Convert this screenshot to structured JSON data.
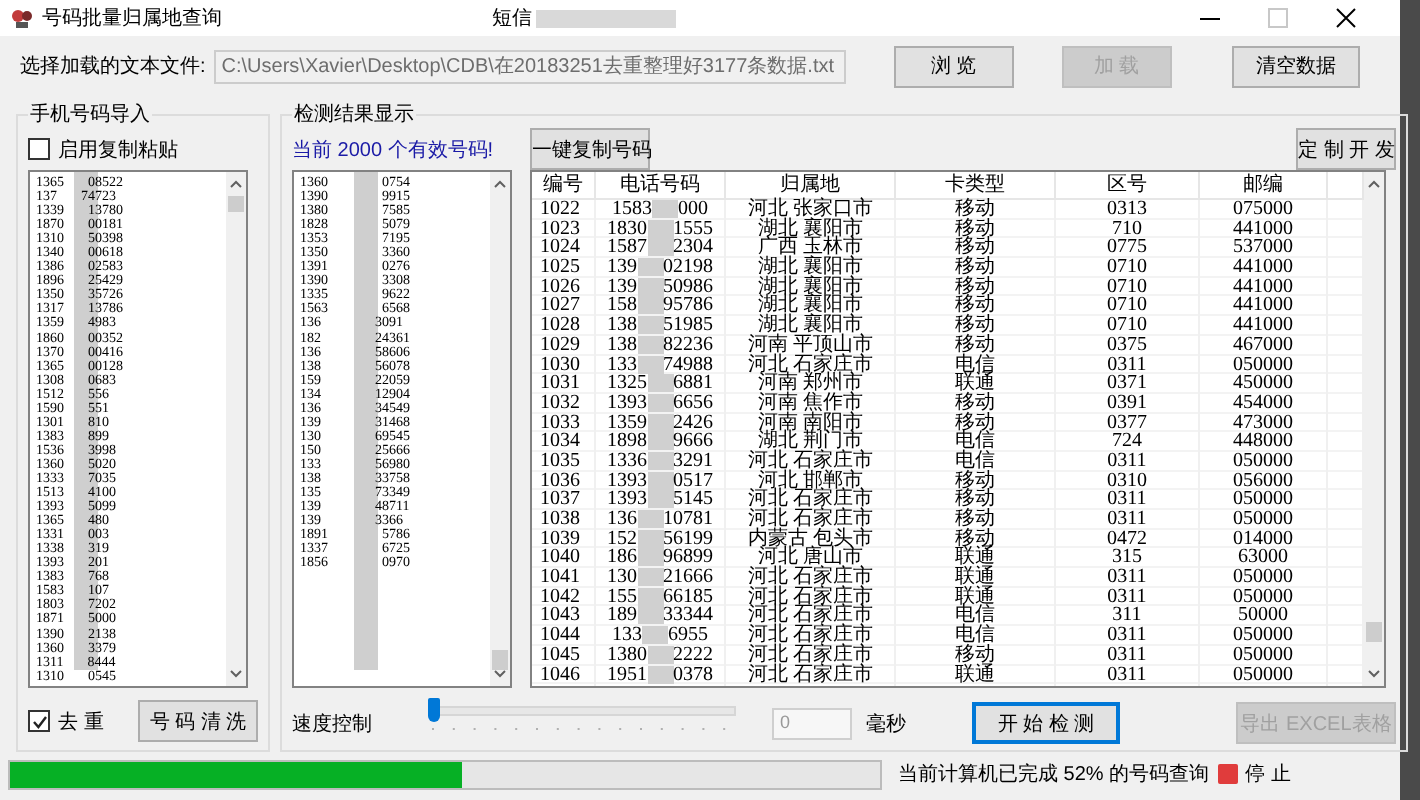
{
  "window": {
    "title": "号码批量归属地查询",
    "center_title": "短信"
  },
  "file_row": {
    "label": "选择加载的文本文件:",
    "path": "C:\\Users\\Xavier\\Desktop\\CDB\\在20183251去重整理好3177条数据.txt",
    "buttons": [
      {
        "label": "浏 览",
        "disabled": false
      },
      {
        "label": "加 载",
        "disabled": true
      },
      {
        "label": "清空数据",
        "disabled": false
      }
    ]
  },
  "import_panel": {
    "title": "手机号码导入",
    "paste_checkbox": {
      "label": "启用复制粘贴",
      "checked": false
    },
    "numbers": [
      {
        "start": "1365",
        "end": "08522"
      },
      {
        "start": "137",
        "end": "74723"
      },
      {
        "start": "1339",
        "end": "13780"
      },
      {
        "start": "1870",
        "end": "00181"
      },
      {
        "start": "1310",
        "end": "50398"
      },
      {
        "start": "1340",
        "end": "00618"
      },
      {
        "start": "1386",
        "end": "02583"
      },
      {
        "start": "1896",
        "end": "25429"
      },
      {
        "start": "1350",
        "end": "35726"
      },
      {
        "start": "1317",
        "end": "13786"
      },
      {
        "start": "1359",
        "end": "4983"
      },
      {
        "start": "1860",
        "end": "00352"
      },
      {
        "start": "1370",
        "end": "00416"
      },
      {
        "start": "1365",
        "end": "00128"
      },
      {
        "start": "1308",
        "end": "0683"
      },
      {
        "start": "1512",
        "end": "556"
      },
      {
        "start": "1590",
        "end": "551"
      },
      {
        "start": "1301",
        "end": "810"
      },
      {
        "start": "1383",
        "end": "899"
      },
      {
        "start": "1536",
        "end": "3998"
      },
      {
        "start": "1360",
        "end": "5020"
      },
      {
        "start": "1333",
        "end": "7035"
      },
      {
        "start": "1513",
        "end": "4100"
      },
      {
        "start": "1393",
        "end": "5099"
      },
      {
        "start": "1365",
        "end": "480"
      },
      {
        "start": "1331",
        "end": "003"
      },
      {
        "start": "1338",
        "end": "319"
      },
      {
        "start": "1393",
        "end": "201"
      },
      {
        "start": "1383",
        "end": "768"
      },
      {
        "start": "1583",
        "end": "107"
      },
      {
        "start": "1803",
        "end": "7202"
      },
      {
        "start": "1871",
        "end": "5000"
      },
      {
        "start": "1390",
        "end": "2138"
      },
      {
        "start": "1360",
        "end": "3379"
      },
      {
        "start": "1311",
        "end": "8444"
      },
      {
        "start": "1310",
        "end": "0545"
      }
    ],
    "dedupe_checkbox": {
      "label": "去 重",
      "checked": true
    },
    "clean_button": "号 码 清 洗"
  },
  "results_panel": {
    "title": "检测结果显示",
    "count_text": "当前 2000 个有效号码!",
    "copy_button": "一键复制号码",
    "custom_button": "定 制 开 发",
    "numbers": [
      {
        "start": "1360",
        "end": "0754"
      },
      {
        "start": "1390",
        "end": "9915"
      },
      {
        "start": "1380",
        "end": "7585"
      },
      {
        "start": "1828",
        "end": "5079"
      },
      {
        "start": "1353",
        "end": "7195"
      },
      {
        "start": "1350",
        "end": "3360"
      },
      {
        "start": "1391",
        "end": "0276"
      },
      {
        "start": "1390",
        "end": "3308"
      },
      {
        "start": "1335",
        "end": "9622"
      },
      {
        "start": "1563",
        "end": "6568"
      },
      {
        "start": "136",
        "end": "3091"
      },
      {
        "start": "182",
        "end": "24361"
      },
      {
        "start": "136",
        "end": "58606"
      },
      {
        "start": "138",
        "end": "56078"
      },
      {
        "start": "159",
        "end": "22059"
      },
      {
        "start": "134",
        "end": "12904"
      },
      {
        "start": "136",
        "end": "34549"
      },
      {
        "start": "139",
        "end": "31468"
      },
      {
        "start": "130",
        "end": "69545"
      },
      {
        "start": "150",
        "end": "25666"
      },
      {
        "start": "133",
        "end": "56980"
      },
      {
        "start": "138",
        "end": "33758"
      },
      {
        "start": "135",
        "end": "73349"
      },
      {
        "start": "139",
        "end": "48711"
      },
      {
        "start": "139",
        "end": "3366"
      },
      {
        "start": "1891",
        "end": "5786"
      },
      {
        "start": "1337",
        "end": "6725"
      },
      {
        "start": "1856",
        "end": "0970"
      }
    ],
    "table": {
      "columns": [
        "编号",
        "电话号码",
        "归属地",
        "卡类型",
        "区号",
        "邮编"
      ],
      "rows": [
        {
          "id": "1022",
          "phone_start": "1583",
          "phone_end": "000",
          "location": "河北 张家口市",
          "carrier": "移动",
          "area_code": "0313",
          "postcode": "075000"
        },
        {
          "id": "1023",
          "phone_start": "1830",
          "phone_end": "1555",
          "location": "湖北 襄阳市",
          "carrier": "移动",
          "area_code": "710",
          "postcode": "441000"
        },
        {
          "id": "1024",
          "phone_start": "1587",
          "phone_end": "2304",
          "location": "广西 玉林市",
          "carrier": "移动",
          "area_code": "0775",
          "postcode": "537000"
        },
        {
          "id": "1025",
          "phone_start": "139",
          "phone_end": "02198",
          "location": "湖北 襄阳市",
          "carrier": "移动",
          "area_code": "0710",
          "postcode": "441000"
        },
        {
          "id": "1026",
          "phone_start": "139",
          "phone_end": "50986",
          "location": "湖北 襄阳市",
          "carrier": "移动",
          "area_code": "0710",
          "postcode": "441000"
        },
        {
          "id": "1027",
          "phone_start": "158",
          "phone_end": "95786",
          "location": "湖北 襄阳市",
          "carrier": "移动",
          "area_code": "0710",
          "postcode": "441000"
        },
        {
          "id": "1028",
          "phone_start": "138",
          "phone_end": "51985",
          "location": "湖北 襄阳市",
          "carrier": "移动",
          "area_code": "0710",
          "postcode": "441000"
        },
        {
          "id": "1029",
          "phone_start": "138",
          "phone_end": "82236",
          "location": "河南 平顶山市",
          "carrier": "移动",
          "area_code": "0375",
          "postcode": "467000"
        },
        {
          "id": "1030",
          "phone_start": "133",
          "phone_end": "74988",
          "location": "河北 石家庄市",
          "carrier": "电信",
          "area_code": "0311",
          "postcode": "050000"
        },
        {
          "id": "1031",
          "phone_start": "1325",
          "phone_end": "6881",
          "location": "河南 郑州市",
          "carrier": "联通",
          "area_code": "0371",
          "postcode": "450000"
        },
        {
          "id": "1032",
          "phone_start": "1393",
          "phone_end": "6656",
          "location": "河南 焦作市",
          "carrier": "移动",
          "area_code": "0391",
          "postcode": "454000"
        },
        {
          "id": "1033",
          "phone_start": "1359",
          "phone_end": "2426",
          "location": "河南 南阳市",
          "carrier": "移动",
          "area_code": "0377",
          "postcode": "473000"
        },
        {
          "id": "1034",
          "phone_start": "1898",
          "phone_end": "9666",
          "location": "湖北 荆门市",
          "carrier": "电信",
          "area_code": "724",
          "postcode": "448000"
        },
        {
          "id": "1035",
          "phone_start": "1336",
          "phone_end": "3291",
          "location": "河北 石家庄市",
          "carrier": "电信",
          "area_code": "0311",
          "postcode": "050000"
        },
        {
          "id": "1036",
          "phone_start": "1393",
          "phone_end": "0517",
          "location": "河北 邯郸市",
          "carrier": "移动",
          "area_code": "0310",
          "postcode": "056000"
        },
        {
          "id": "1037",
          "phone_start": "1393",
          "phone_end": "5145",
          "location": "河北 石家庄市",
          "carrier": "移动",
          "area_code": "0311",
          "postcode": "050000"
        },
        {
          "id": "1038",
          "phone_start": "136",
          "phone_end": "10781",
          "location": "河北 石家庄市",
          "carrier": "移动",
          "area_code": "0311",
          "postcode": "050000"
        },
        {
          "id": "1039",
          "phone_start": "152",
          "phone_end": "56199",
          "location": "内蒙古 包头市",
          "carrier": "移动",
          "area_code": "0472",
          "postcode": "014000"
        },
        {
          "id": "1040",
          "phone_start": "186",
          "phone_end": "96899",
          "location": "河北 唐山市",
          "carrier": "联通",
          "area_code": "315",
          "postcode": "63000"
        },
        {
          "id": "1041",
          "phone_start": "130",
          "phone_end": "21666",
          "location": "河北 石家庄市",
          "carrier": "联通",
          "area_code": "0311",
          "postcode": "050000"
        },
        {
          "id": "1042",
          "phone_start": "155",
          "phone_end": "66185",
          "location": "河北 石家庄市",
          "carrier": "联通",
          "area_code": "0311",
          "postcode": "050000"
        },
        {
          "id": "1043",
          "phone_start": "189",
          "phone_end": "33344",
          "location": "河北 石家庄市",
          "carrier": "电信",
          "area_code": "311",
          "postcode": "50000"
        },
        {
          "id": "1044",
          "phone_start": "133",
          "phone_end": "6955",
          "location": "河北 石家庄市",
          "carrier": "电信",
          "area_code": "0311",
          "postcode": "050000"
        },
        {
          "id": "1045",
          "phone_start": "1380",
          "phone_end": "2222",
          "location": "河北 石家庄市",
          "carrier": "移动",
          "area_code": "0311",
          "postcode": "050000"
        },
        {
          "id": "1046",
          "phone_start": "1951",
          "phone_end": "0378",
          "location": "河北 石家庄市",
          "carrier": "联通",
          "area_code": "0311",
          "postcode": "050000"
        }
      ]
    },
    "speed": {
      "label": "速度控制",
      "level": 0,
      "delay_value": "0",
      "unit": "毫秒"
    },
    "start_button": {
      "label": "开 始 检 测",
      "focused": true
    },
    "export_button": {
      "label": "导出 EXCEL表格",
      "disabled": true
    }
  },
  "status_bar": {
    "progress": {
      "level": 0.52
    },
    "text": "当前计算机已完成 52% 的号码查询",
    "stop_label": "停 止"
  }
}
